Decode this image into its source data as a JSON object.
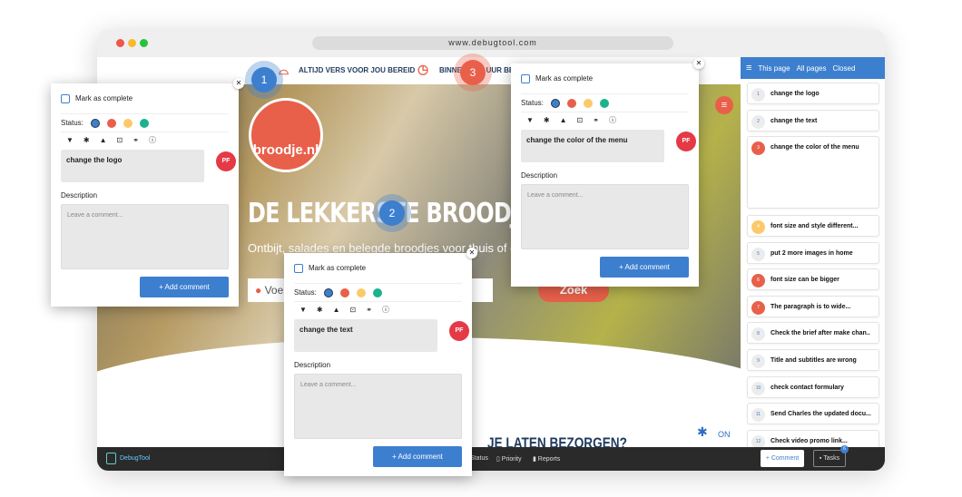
{
  "browser": {
    "url": "www.debugtool.com"
  },
  "site": {
    "strip_items": [
      "ALTIJD VERS VOOR JOU BEREID",
      "BINNEN ÉÉN UUR BEZORGD OP"
    ],
    "logo_text": "broodje.nl",
    "headline": "DE LEKKERSTE BROODJES BESTELLEN",
    "subtitle": "Ontbijt, salades en belegde broodjes voor thuis of op",
    "search_placeholder": "Voer",
    "search_button": "Zoek",
    "section_title": "JE LATEN BEZORGEN?"
  },
  "panel": {
    "tabs": [
      "This page",
      "All pages",
      "Closed"
    ],
    "tasks": [
      {
        "n": "1",
        "text": "change the logo",
        "color": "#ececec"
      },
      {
        "n": "2",
        "text": "change the text",
        "color": "#ececec"
      },
      {
        "n": "3",
        "text": "change the color of the menu",
        "color": "#e8604a"
      },
      {
        "n": "4",
        "text": "font size and style different...",
        "color": "#fcc96a"
      },
      {
        "n": "5",
        "text": "put 2 more images in home",
        "color": "#ececec"
      },
      {
        "n": "6",
        "text": "font size can be bigger",
        "color": "#e8604a"
      },
      {
        "n": "7",
        "text": "The paragraph is to wide...",
        "color": "#e8604a"
      },
      {
        "n": "8",
        "text": "Check the brief after make chan..",
        "color": "#ececec"
      },
      {
        "n": "9",
        "text": "Title and subtitles are wrong",
        "color": "#ececec"
      },
      {
        "n": "10",
        "text": "check contact formulary",
        "color": "#ececec"
      },
      {
        "n": "11",
        "text": "Send Charles the updated docu...",
        "color": "#ececec"
      },
      {
        "n": "12",
        "text": "Check video promo link...",
        "color": "#ececec"
      }
    ]
  },
  "toolbar": {
    "brand": "DebugTool",
    "items": [
      "Status",
      "Priority",
      "Reports"
    ],
    "comment_button": "+ Comment",
    "tasks_button": "Tasks",
    "tasks_badge": "6",
    "debug_toggle": "ON"
  },
  "popup_labels": {
    "mark_complete": "Mark as complete",
    "status": "Status:",
    "description": "Description",
    "placeholder": "Leave a comment...",
    "add_comment": "+ Add comment",
    "avatar": "PF"
  },
  "status_colors": [
    "#3d7fcf",
    "#e8604a",
    "#fcc96a",
    "#1bb28c"
  ],
  "popups": [
    {
      "marker": "1",
      "title": "change the logo"
    },
    {
      "marker": "2",
      "title": "change the text"
    },
    {
      "marker": "3",
      "title": "change the color of the menu"
    }
  ]
}
